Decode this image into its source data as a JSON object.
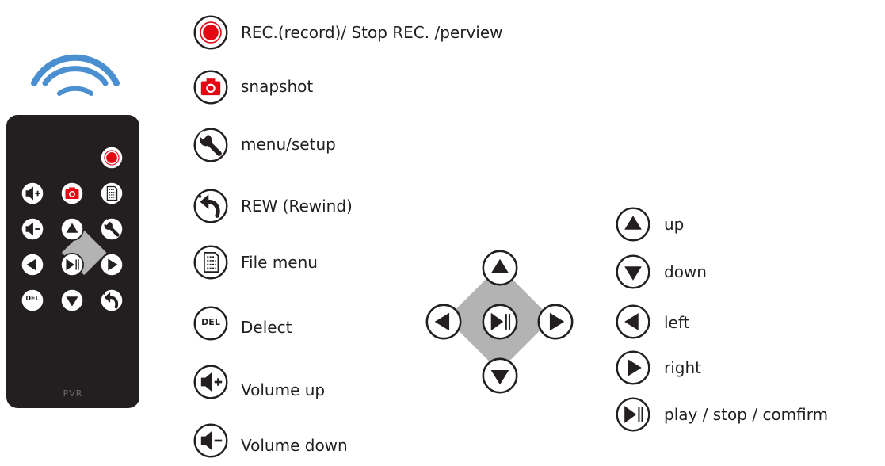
{
  "remote": {
    "model_label": "PVR"
  },
  "colors": {
    "record_red": "#e30613",
    "remote_body": "#231f20",
    "pad_gray": "#b3b3b3",
    "signal_blue": "#4a8fcf"
  },
  "legend_left": [
    {
      "icon": "record-icon",
      "label": "REC.(record)/ Stop REC. /perview"
    },
    {
      "icon": "camera-icon",
      "label": "snapshot"
    },
    {
      "icon": "wrench-icon",
      "label": "menu/setup"
    },
    {
      "icon": "rewind-icon",
      "label": "REW (Rewind)"
    },
    {
      "icon": "file-icon",
      "label": "File menu"
    },
    {
      "icon": "del-icon",
      "label": "Delect",
      "badge": "DEL"
    },
    {
      "icon": "volume-up-icon",
      "label": "Volume up"
    },
    {
      "icon": "volume-down-icon",
      "label": "Volume down"
    }
  ],
  "legend_right": [
    {
      "icon": "up-arrow-icon",
      "label": "up"
    },
    {
      "icon": "down-arrow-icon",
      "label": "down"
    },
    {
      "icon": "left-arrow-icon",
      "label": "left"
    },
    {
      "icon": "right-arrow-icon",
      "label": "right"
    },
    {
      "icon": "play-pause-icon",
      "label": "play / stop / comfirm"
    }
  ]
}
